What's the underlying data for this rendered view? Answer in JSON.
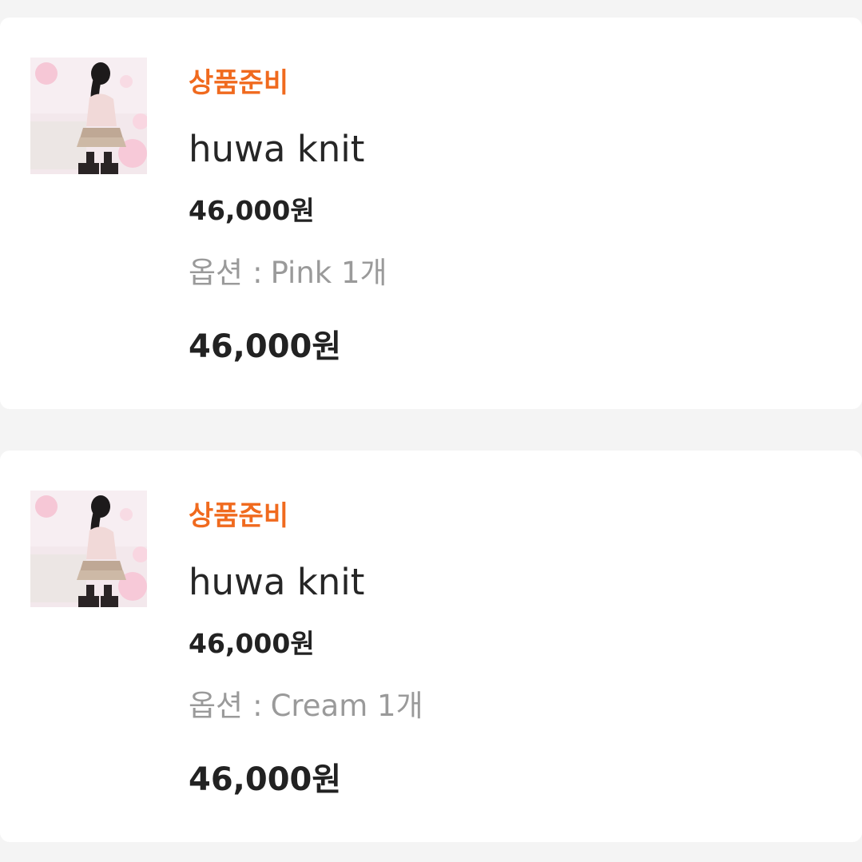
{
  "colors": {
    "background": "#f4f4f4",
    "card": "#ffffff",
    "status": "#f06a1e",
    "title": "#262626",
    "price": "#222222",
    "option": "#9a9a9a"
  },
  "orders": [
    {
      "status": "상품준비",
      "product_name": "huwa knit",
      "unit_price": "46,000원",
      "option_label": "옵션",
      "option_sep": ":",
      "option_value": "Pink 1개",
      "total_price": "46,000원",
      "thumbnail_icon": "product-photo-icon"
    },
    {
      "status": "상품준비",
      "product_name": "huwa knit",
      "unit_price": "46,000원",
      "option_label": "옵션",
      "option_sep": ":",
      "option_value": "Cream 1개",
      "total_price": "46,000원",
      "thumbnail_icon": "product-photo-icon"
    }
  ]
}
